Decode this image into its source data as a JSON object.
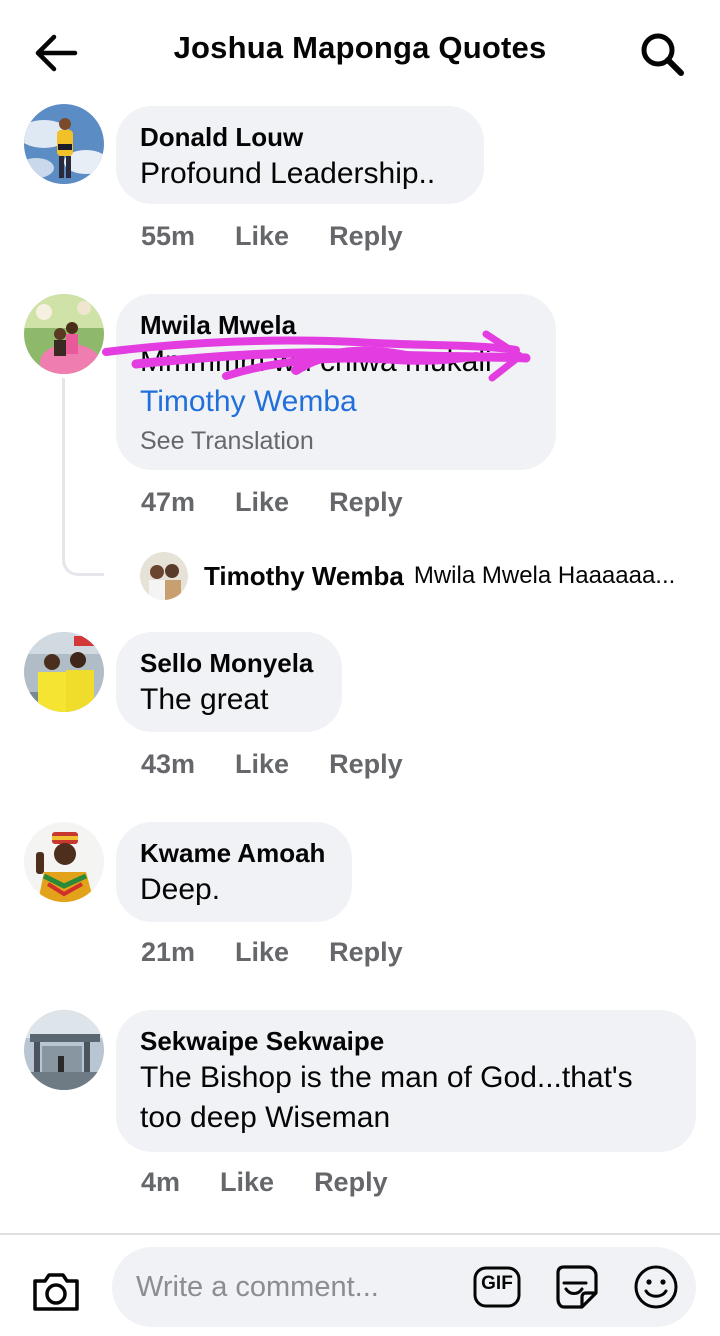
{
  "header": {
    "title": "Joshua Maponga Quotes",
    "back_icon": "arrow-left-icon",
    "search_icon": "search-icon"
  },
  "comments": [
    {
      "author": "Donald Louw",
      "text": "Profound Leadership..",
      "time": "55m",
      "like_label": "Like",
      "reply_label": "Reply"
    },
    {
      "author": "Mwila Mwela",
      "text": "Mmmmm wu chiwa mukali",
      "mention": "Timothy Wemba",
      "see_translation": "See Translation",
      "time": "47m",
      "like_label": "Like",
      "reply_label": "Reply",
      "reply_preview": {
        "author": "Timothy Wemba",
        "text": "Mwila Mwela Haaaaaa..."
      }
    },
    {
      "author": "Sello Monyela",
      "text": "The great",
      "time": "43m",
      "like_label": "Like",
      "reply_label": "Reply"
    },
    {
      "author": "Kwame Amoah",
      "text": "Deep.",
      "time": "21m",
      "like_label": "Like",
      "reply_label": "Reply"
    },
    {
      "author": "Sekwaipe Sekwaipe",
      "text_line1": "The Bishop is the man of God...that's",
      "text_line2": "too deep Wiseman",
      "time": "4m",
      "like_label": "Like",
      "reply_label": "Reply"
    }
  ],
  "composer": {
    "placeholder": "Write a comment...",
    "camera_icon": "camera-icon",
    "gif_label": "GIF",
    "sticker_icon": "sticker-icon",
    "emoji_icon": "emoji-icon"
  },
  "colors": {
    "bubble_bg": "#f0f2f5",
    "mention": "#216fdb",
    "meta": "#65676b",
    "scribble": "#e33ce0"
  }
}
